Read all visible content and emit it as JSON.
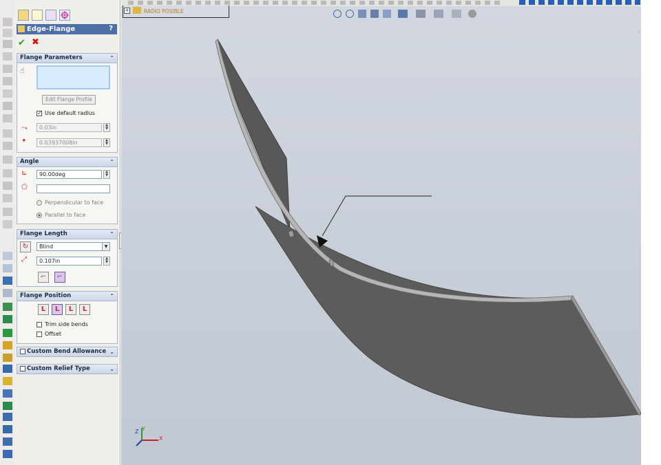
{
  "feature": {
    "title": "Edge-Flange",
    "help": "?",
    "ok_icon": "check-icon",
    "cancel_icon": "x-icon"
  },
  "tree": {
    "node_label": "RADIO POSIBLE"
  },
  "flange_parameters": {
    "header": "Flange Parameters",
    "edit_profile_label": "Edit Flange Profile",
    "use_default_radius_label": "Use default radius",
    "use_default_radius_checked": true,
    "radius_value": "0.03in",
    "thickness_value": "0.03937008in"
  },
  "angle": {
    "header": "Angle",
    "value": "90.00deg",
    "face_value": "",
    "perpendicular_label": "Perpendicular to face",
    "parallel_label": "Parallel to face",
    "selected_option": "parallel"
  },
  "flange_length": {
    "header": "Flange Length",
    "end_condition": "Blind",
    "length_value": "0.107in"
  },
  "flange_position": {
    "header": "Flange Position",
    "trim_label": "Trim side bends",
    "trim_checked": false,
    "offset_label": "Offset",
    "offset_checked": false
  },
  "custom_bend_allowance": {
    "label": "Custom Bend Allowance",
    "checked": false
  },
  "custom_relief_type": {
    "label": "Custom Relief Type",
    "checked": false
  },
  "triad": {
    "x": "X",
    "y": "Y",
    "z": "Z"
  },
  "colors": {
    "title_bar": "#4c6fa8",
    "canvas": "#cbd0da",
    "sheet_metal": "#5c5c5c",
    "sheet_edge": "#b4b4b4"
  }
}
